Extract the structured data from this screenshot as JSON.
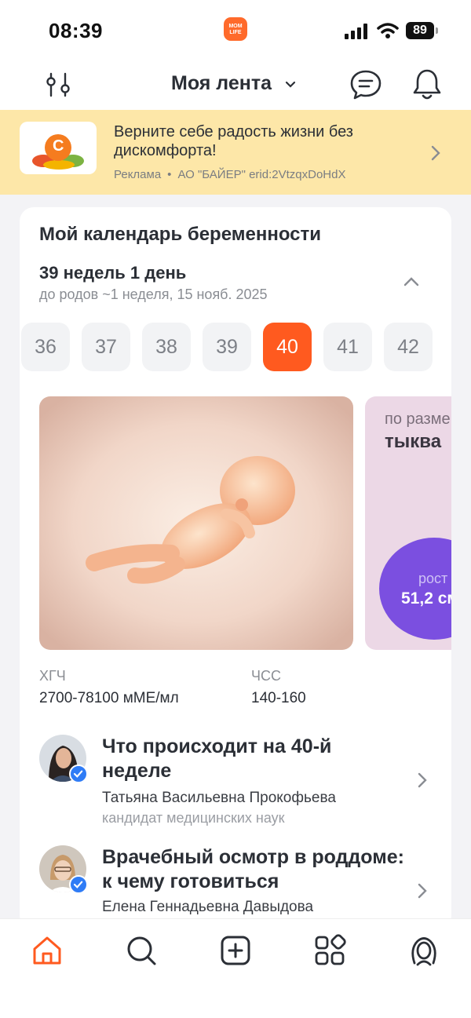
{
  "status_bar": {
    "time": "08:39",
    "app_logo_text": "MOM LIFE",
    "battery": "89"
  },
  "header": {
    "title": "Моя лента",
    "icons": [
      "filter-icon",
      "chevron-down-icon",
      "chat-icon",
      "bell-icon"
    ]
  },
  "ad": {
    "text": "Верните себе радость жизни без дискомфорта!",
    "label": "Реклама",
    "advertiser": "АО \"БАЙЕР\" erid:2VtzqxDoHdX",
    "thumb_letter": "C"
  },
  "calendar": {
    "title": "Мой календарь беременности",
    "weeks_title": "39 недель 1 день",
    "due_text": "до родов ~1 неделя, 15 нояб. 2025",
    "weeks": [
      "36",
      "37",
      "38",
      "39",
      "40",
      "41",
      "42"
    ],
    "selected_week": "40",
    "size_card": {
      "label": "по разме",
      "fruit": "тыква",
      "metric_label": "рост",
      "metric_value": "51,2 см"
    },
    "stats": [
      {
        "label": "ХГЧ",
        "value": "2700-78100 мМЕ/мл"
      },
      {
        "label": "ЧСС",
        "value": "140-160"
      }
    ]
  },
  "articles": [
    {
      "title": "Что происходит на 40-й неделе",
      "author": "Татьяна Васильевна Прокофьева",
      "role": "кандидат медицинских наук"
    },
    {
      "title": "Врачебный осмотр в роддоме: к чему готовиться",
      "author": "Елена Геннадьевна Давыдова"
    }
  ],
  "bottom_nav": [
    "home-icon",
    "search-icon",
    "add-icon",
    "services-icon",
    "profile-icon"
  ],
  "colors": {
    "accent": "#ff5a1f",
    "ad_background": "#fde7a8",
    "size_circle": "#7b4fe0",
    "verified": "#2f7cf6"
  }
}
